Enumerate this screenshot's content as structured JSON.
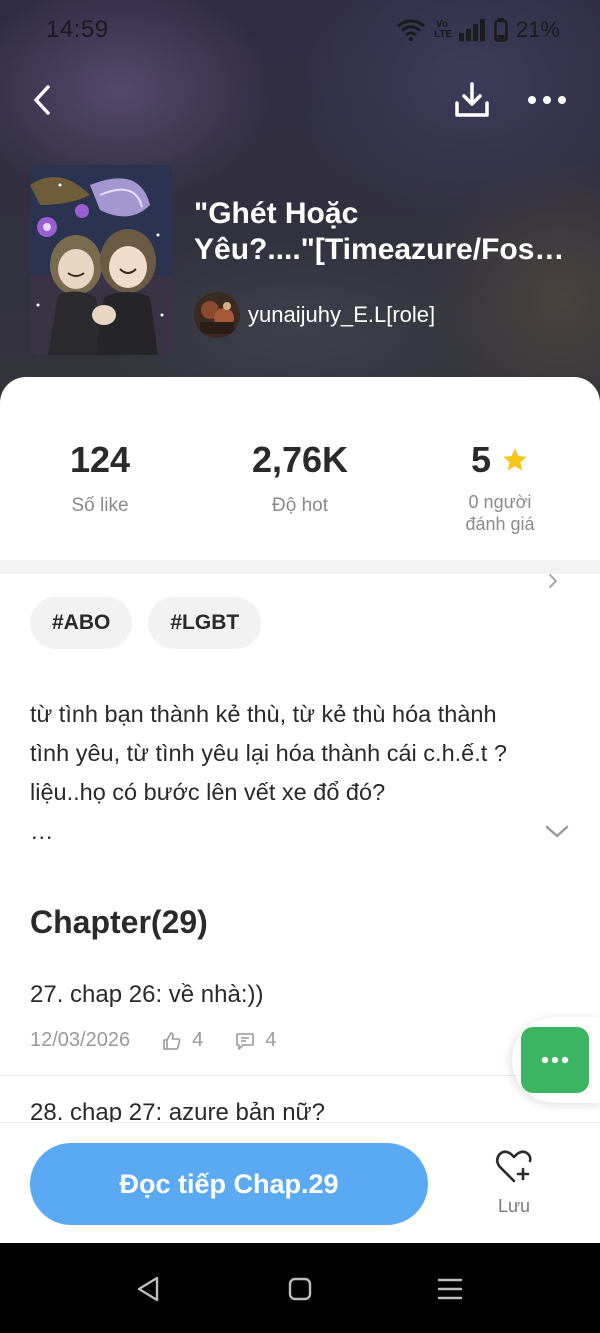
{
  "status_bar": {
    "time": "14:59",
    "volte_label": "Vo LTE",
    "battery": "21%"
  },
  "header": {
    "back_icon": "chevron-left-icon",
    "download_icon": "download-icon",
    "more_icon": "more-horizontal-icon"
  },
  "book": {
    "title_line1": "\"Ghét Hoặc",
    "title_line2": "Yêu?....\"[Timeazure/Fos…",
    "author": "yunaijuhy_E.L[role]"
  },
  "stats": {
    "likes_value": "124",
    "likes_label": "Số like",
    "hot_value": "2,76K",
    "hot_label": "Độ hot",
    "rating_value": "5",
    "rating_label_line1": "0 người",
    "rating_label_line2": "đánh giá"
  },
  "tags": [
    "#ABO",
    "#LGBT"
  ],
  "description": {
    "text": "từ tình bạn thành kẻ thù, từ kẻ thù hóa thành tình yêu, từ tình yêu lại hóa thành cái c.h.ế.t ? liệu..họ có bước lên vết xe đổ đó?",
    "ellipsis": "…"
  },
  "chapters": {
    "heading": "Chapter(29)",
    "items": [
      {
        "title": "27. chap 26: về nhà:))",
        "date": "12/03/2026",
        "likes": "4",
        "comments": "4"
      },
      {
        "title": "28. chap 27: azure bản nữ?"
      }
    ]
  },
  "action_bar": {
    "read_button": "Đọc tiếp Chap.29",
    "save_label": "Lưu"
  },
  "colors": {
    "accent_blue": "#5aaaf3",
    "float_green": "#3cb562",
    "star_yellow": "#f5c518",
    "text_dark": "#2a2a2a",
    "text_muted": "#8b8b8b"
  }
}
